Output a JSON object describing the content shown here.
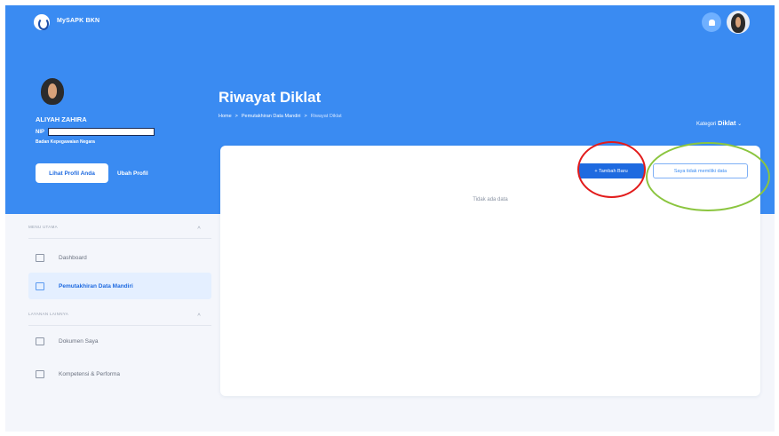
{
  "app": {
    "name": "MySAPK BKN"
  },
  "user": {
    "name": "ALIYAH ZAHIRA",
    "nip_label": "NIP",
    "agency": "Badan Kepegawaian Negara",
    "view_profile_label": "Lihat Profil Anda",
    "edit_profile_label": "Ubah Profil"
  },
  "header": {
    "title": "Riwayat Diklat",
    "breadcrumb": [
      "Home",
      ">",
      "Pemutakhiran Data Mandiri",
      ">",
      "Riwayat Diklat"
    ],
    "kategori_label": "Kategori",
    "kategori_value": "Diklat",
    "kategori_chevron": "⌄"
  },
  "sidebar": {
    "sections": [
      {
        "title": "MENU UTAMA",
        "chevron": "^",
        "items": [
          {
            "label": "Dashboard",
            "icon": "dashboard-icon",
            "active": false
          },
          {
            "label": "Pemutakhiran Data Mandiri",
            "icon": "list-icon",
            "active": true
          }
        ]
      },
      {
        "title": "LAYANAN LAINNYA",
        "chevron": "^",
        "items": [
          {
            "label": "Dokumen Saya",
            "icon": "folder-icon",
            "active": false
          },
          {
            "label": "Kompetensi & Performa",
            "icon": "grid-icon",
            "active": false
          }
        ]
      }
    ]
  },
  "main": {
    "add_button_label": "+ Tambah Baru",
    "no_data_button_label": "Saya tidak memiliki data",
    "empty_text": "Tidak ada data"
  },
  "colors": {
    "primary": "#3a8bf2",
    "button_blue": "#1e6ae0",
    "annotation_red": "#e21b1b",
    "annotation_green": "#8bc53f"
  }
}
